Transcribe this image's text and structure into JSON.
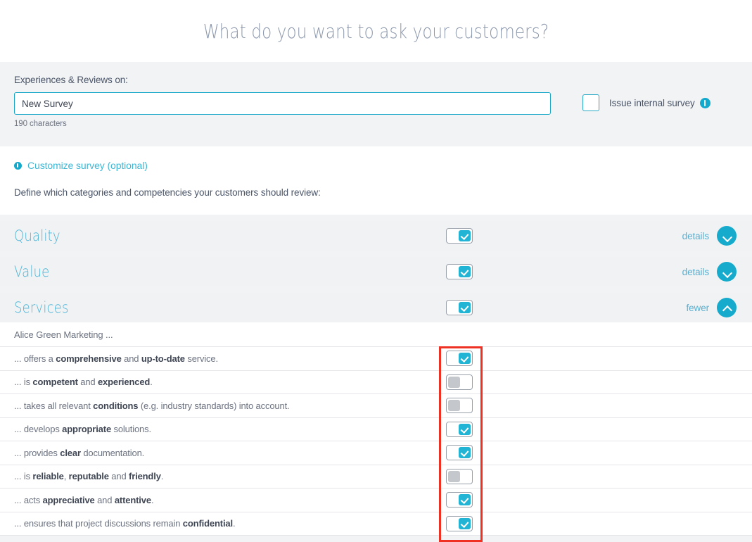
{
  "header": {
    "title": "What do you want to ask your customers?"
  },
  "survey_form": {
    "name_label": "Experiences & Reviews on:",
    "survey_name_value": "New Survey",
    "survey_name_placeholder": "New Survey",
    "char_count": "190 characters",
    "internal_survey_label": "Issue internal survey",
    "internal_survey_checked": false,
    "info_icon": "info-icon"
  },
  "customize": {
    "link_label": "Customize survey (optional)",
    "description": "Define which categories and competencies your customers should review:"
  },
  "categories": [
    {
      "name": "Quality",
      "enabled": true,
      "action_label": "details",
      "expanded": false,
      "chevron": "chevron-down-icon"
    },
    {
      "name": "Value",
      "enabled": true,
      "action_label": "details",
      "expanded": false,
      "chevron": "chevron-down-icon"
    },
    {
      "name": "Services",
      "enabled": true,
      "action_label": "fewer",
      "expanded": true,
      "chevron": "chevron-up-icon"
    }
  ],
  "expanded_section": {
    "subject_line": "Alice Green Marketing ...",
    "competencies": [
      {
        "prefix": "... offers a ",
        "segments": [
          [
            "comprehensive",
            true
          ],
          [
            " and ",
            false
          ],
          [
            "up-to-date",
            true
          ],
          [
            " service.",
            false
          ]
        ],
        "enabled": true
      },
      {
        "prefix": "... is ",
        "segments": [
          [
            "competent",
            true
          ],
          [
            " and ",
            false
          ],
          [
            "experienced",
            true
          ],
          [
            ".",
            false
          ]
        ],
        "enabled": false
      },
      {
        "prefix": "... takes all relevant ",
        "segments": [
          [
            "conditions",
            true
          ],
          [
            " (e.g. industry standards) into account.",
            false
          ]
        ],
        "enabled": false
      },
      {
        "prefix": "... develops ",
        "segments": [
          [
            "appropriate",
            true
          ],
          [
            " solutions.",
            false
          ]
        ],
        "enabled": true
      },
      {
        "prefix": "... provides ",
        "segments": [
          [
            "clear",
            true
          ],
          [
            " documentation.",
            false
          ]
        ],
        "enabled": true
      },
      {
        "prefix": "... is ",
        "segments": [
          [
            "reliable",
            true
          ],
          [
            ", ",
            false
          ],
          [
            "reputable",
            true
          ],
          [
            " and ",
            false
          ],
          [
            "friendly",
            true
          ],
          [
            ".",
            false
          ]
        ],
        "enabled": false
      },
      {
        "prefix": "... acts ",
        "segments": [
          [
            "appreciative",
            true
          ],
          [
            " and ",
            false
          ],
          [
            "attentive",
            true
          ],
          [
            ".",
            false
          ]
        ],
        "enabled": true
      },
      {
        "prefix": "... ensures that project discussions remain ",
        "segments": [
          [
            "confidential",
            true
          ],
          [
            ".",
            false
          ]
        ],
        "enabled": true
      }
    ]
  },
  "annotation": {
    "highlight_color": "#ef3124",
    "target": "competency-toggle-column"
  },
  "colors": {
    "accent_teal": "#16abcd",
    "toggle_on": "#21b4d4",
    "toggle_off": "#c4c7cc",
    "panel_gray": "#f2f3f5",
    "title_gray": "#8d99ad"
  }
}
